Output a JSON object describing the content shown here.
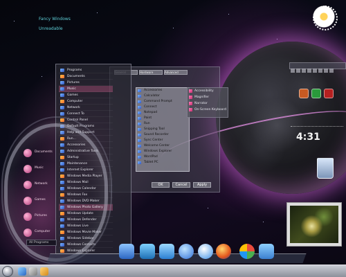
{
  "desktop": {
    "corner_text": [
      "Fancy Windows",
      "Unreadable"
    ],
    "colors": {
      "accent_pink": "#d46fb0",
      "planet_glow": "#dc6ee6",
      "taskbar": "#a9adb7"
    }
  },
  "start_menu": {
    "items": [
      "Programs",
      "Documents",
      "Pictures",
      "Music",
      "Games",
      "Computer",
      "Network",
      "Connect To",
      "Control Panel",
      "Default Programs",
      "Help and Support",
      "Run...",
      "Accessories",
      "Administrative Tools",
      "Startup",
      "Maintenance",
      "Internet Explorer",
      "Windows Media Player",
      "Windows Mail",
      "Windows Calendar",
      "Windows Fax",
      "Windows DVD Maker",
      "Windows Photo Gallery",
      "Windows Update",
      "Windows Defender",
      "Windows Live",
      "Windows Movie Maker",
      "Windows Sidebar",
      "Windows Contacts",
      "Windows Explorer"
    ],
    "left_panel": [
      "Documents",
      "Music",
      "Network",
      "Games",
      "Pictures",
      "Computer"
    ],
    "search_placeholder": "All Programs"
  },
  "submenu": {
    "items": [
      "Accessories",
      "Calculator",
      "Command Prompt",
      "Connect",
      "Notepad",
      "Paint",
      "Run",
      "Snipping Tool",
      "Sound Recorder",
      "Sync Center",
      "Welcome Center",
      "Windows Explorer",
      "WordPad",
      "Tablet PC"
    ]
  },
  "submenu2": {
    "items": [
      "Accessibility",
      "Magnifier",
      "Narrator",
      "On-Screen Keyboard"
    ]
  },
  "dialog": {
    "tabs": [
      "General",
      "Hardware",
      "Advanced"
    ],
    "ok_label": "OK",
    "cancel_label": "Cancel",
    "apply_label": "Apply"
  },
  "gadgets": {
    "clock_time": "4:31"
  }
}
